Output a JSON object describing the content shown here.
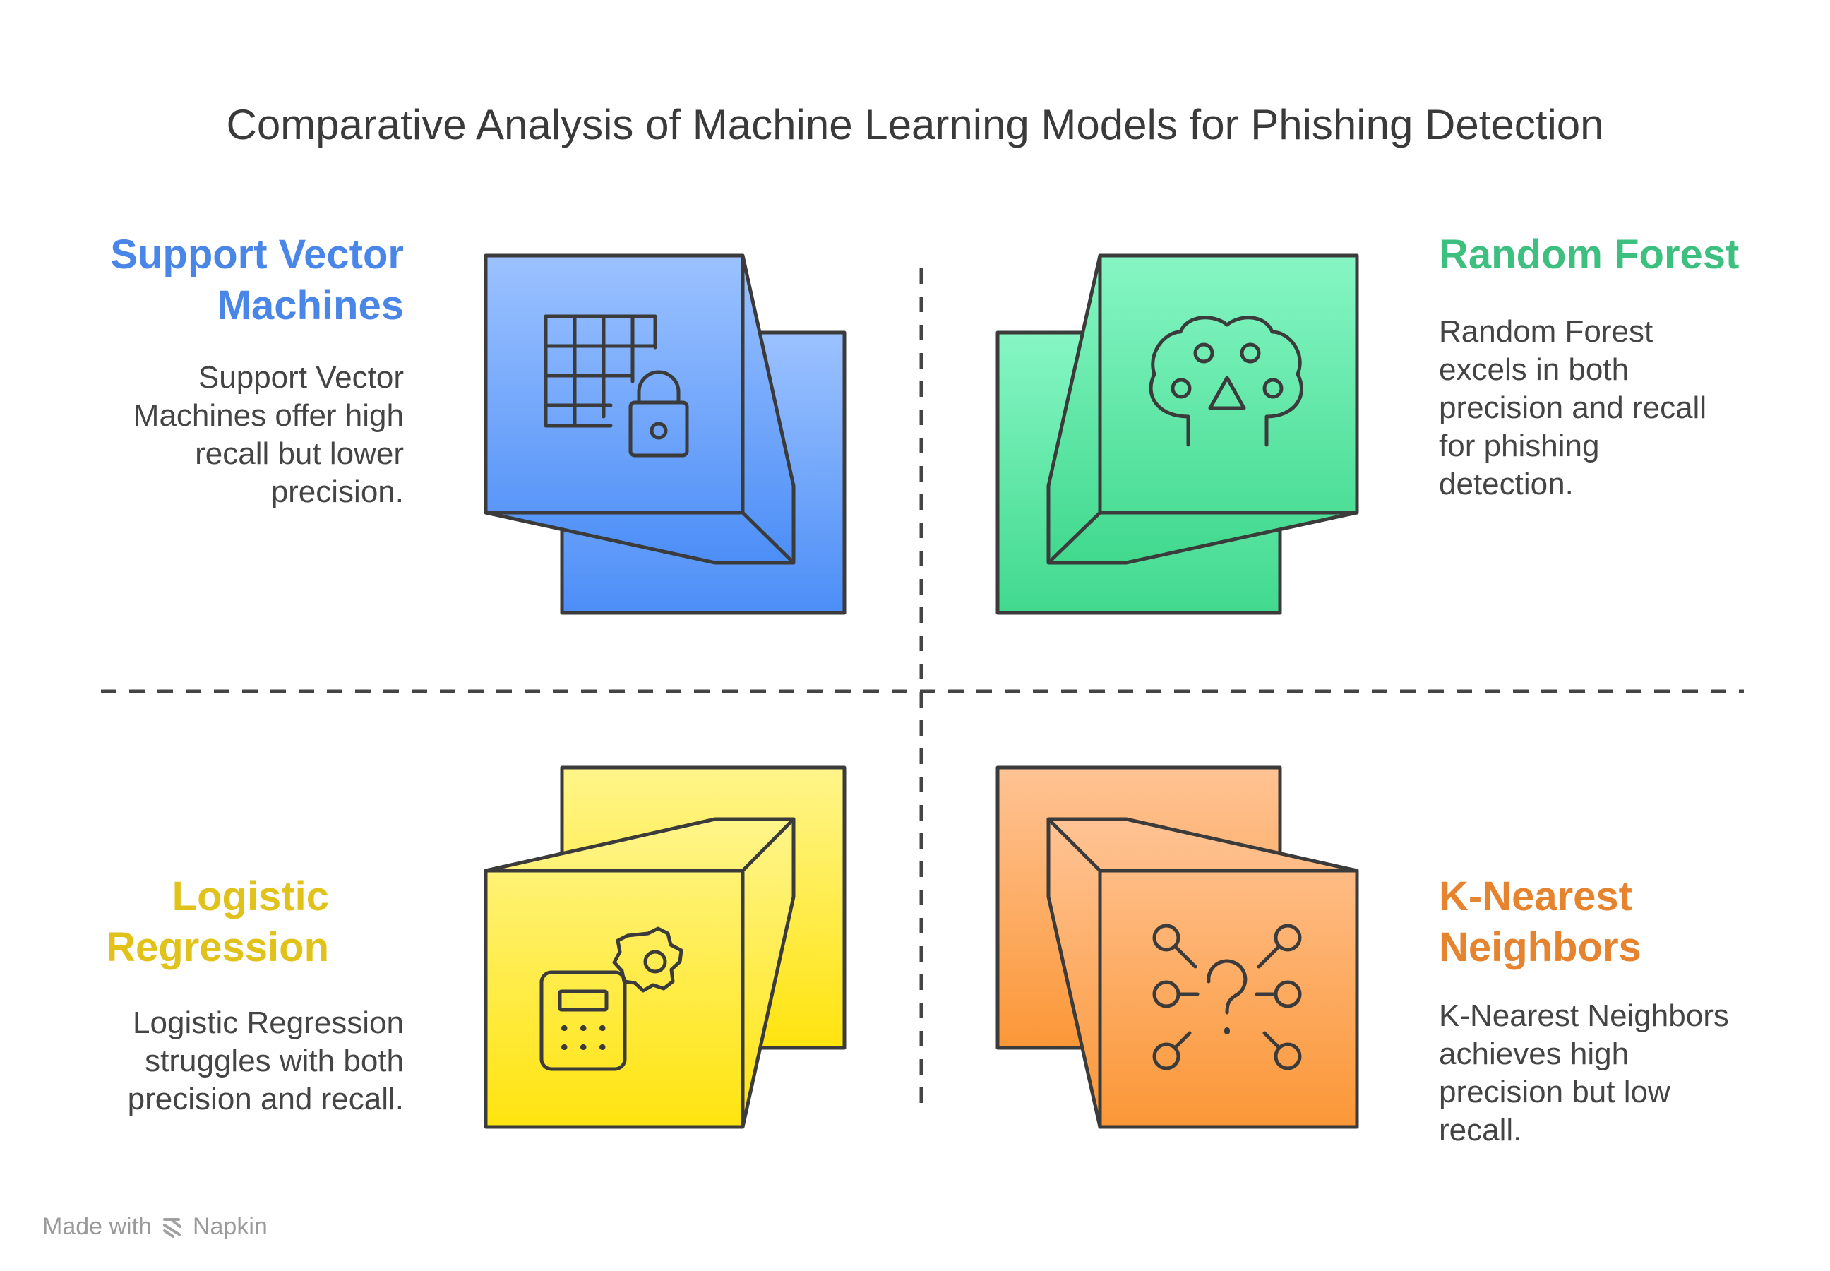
{
  "title": "Comparative Analysis of Machine Learning Models for Phishing Detection",
  "quadrants": [
    {
      "title": "Support Vector Machines",
      "description": "Support Vector Machines offer high recall but lower precision.",
      "icon": "grid-lock-icon",
      "color": "#4a86e8"
    },
    {
      "title": "Random Forest",
      "description": "Random Forest excels in both precision and recall for phishing detection.",
      "icon": "paw-tree-icon",
      "color": "#3dbf7f"
    },
    {
      "title": "Logistic Regression",
      "description": "Logistic Regression struggles with both precision and recall.",
      "icon": "calculator-gear-icon",
      "color": "#e1c21b"
    },
    {
      "title": "K-Nearest Neighbors",
      "description": "K-Nearest Neighbors achieves high precision but low recall.",
      "icon": "network-question-icon",
      "color": "#e5832f"
    }
  ],
  "footer": {
    "made_with": "Made with",
    "brand": "Napkin"
  }
}
